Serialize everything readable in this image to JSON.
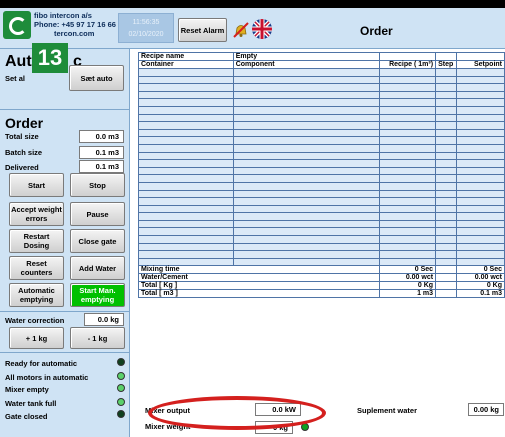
{
  "header": {
    "company_line1": "fibo intercon a/s",
    "company_line2": "Phone: +45 97 17 16 66",
    "company_line3": "tercon.com",
    "clock_time": "11:56:35",
    "clock_date": "02/10/2020",
    "reset_alarm_label": "Reset Alarm",
    "page_title": "Order"
  },
  "sidebar": {
    "panel_number": "13",
    "auto_title_left": "Aut",
    "auto_title_right": "c",
    "set_al_label": "Set al",
    "set_auto_label": "Sæt auto",
    "order_title": "Order",
    "total_size_label": "Total size",
    "total_size_value": "0.0 m3",
    "batch_size_label": "Batch size",
    "batch_size_value": "0.1 m3",
    "delivered_label": "Delivered",
    "delivered_value": "0.1 m3",
    "buttons": {
      "start": "Start",
      "stop": "Stop",
      "accept": "Accept weight errors",
      "pause": "Pause",
      "restart": "Restart Dosing",
      "close_gate": "Close gate",
      "reset_counters": "Reset counters",
      "add_water": "Add Water",
      "auto_emptying": "Automatic emptying",
      "start_man_emptying": "Start Man. emptying"
    },
    "water_correction_label": "Water correction",
    "water_correction_value": "0.0 kg",
    "plus_1kg": "+ 1 kg",
    "minus_1kg": "- 1 kg",
    "status": [
      {
        "label": "Ready for automatic",
        "led": "dark"
      },
      {
        "label": "All motors in automatic",
        "led": "green"
      },
      {
        "label": "Mixer empty",
        "led": "green"
      },
      {
        "label": "Water tank full",
        "led": "green"
      },
      {
        "label": "Gate closed",
        "led": "dark"
      }
    ]
  },
  "table": {
    "recipe_name_label": "Recipe name",
    "recipe_name_value": "Empty",
    "columns": [
      "Container",
      "Component",
      "Recipe ( 1m³)",
      "Step",
      "Setpoint"
    ],
    "empty_rows": 26,
    "footer": [
      {
        "label": "Mixing time",
        "recipe": "0 Sec",
        "setpoint": "0 Sec"
      },
      {
        "label": "Water/Cement",
        "recipe": "0.00 wct",
        "setpoint": "0.00 wct"
      },
      {
        "label": "Total [ Kg ]",
        "recipe": "0 Kg",
        "setpoint": "0 Kg"
      },
      {
        "label": "Total [ m3 ]",
        "recipe": "1 m3",
        "setpoint": "0.1 m3"
      }
    ]
  },
  "bottom": {
    "mixer_output_label": "Mixer output",
    "mixer_output_value": "0.0 kW",
    "mixer_weight_label": "Mixer weight",
    "mixer_weight_value": "0 kg",
    "supplement_water_label": "Suplement water",
    "supplement_water_value": "0.00 kg"
  },
  "colors": {
    "panel_bg": "#cfe3f4",
    "brand_green": "#1e8c3a",
    "grid_line": "#4f74a6",
    "highlight_red": "#d4201e",
    "active_button": "#00c000"
  }
}
